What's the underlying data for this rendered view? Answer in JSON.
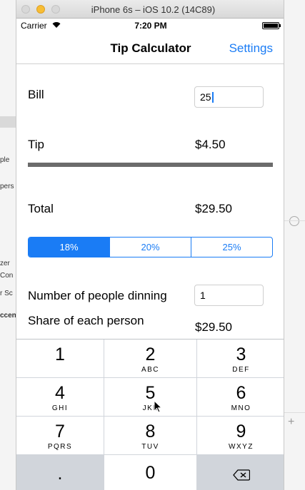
{
  "window": {
    "title": "iPhone 6s – iOS 10.2 (14C89)"
  },
  "status_bar": {
    "carrier": "Carrier",
    "time": "7:20 PM"
  },
  "nav": {
    "title": "Tip Calculator",
    "settings_label": "Settings"
  },
  "form": {
    "bill_label": "Bill",
    "bill_value": "25",
    "tip_label": "Tip",
    "tip_value": "$4.50",
    "total_label": "Total",
    "total_value": "$29.50",
    "tip_options": [
      "18%",
      "20%",
      "25%"
    ],
    "selected_tip_index": 0,
    "people_label": "Number of people dinning",
    "people_value": "1",
    "share_label": "Share of each person",
    "share_value": "$29.50"
  },
  "keypad": {
    "keys": [
      {
        "num": "1",
        "sub": ""
      },
      {
        "num": "2",
        "sub": "ABC"
      },
      {
        "num": "3",
        "sub": "DEF"
      },
      {
        "num": "4",
        "sub": "GHI"
      },
      {
        "num": "5",
        "sub": "JKL"
      },
      {
        "num": "6",
        "sub": "MNO"
      },
      {
        "num": "7",
        "sub": "PQRS"
      },
      {
        "num": "8",
        "sub": "TUV"
      },
      {
        "num": "9",
        "sub": "WXYZ"
      },
      {
        "num": ".",
        "sub": ""
      },
      {
        "num": "0",
        "sub": ""
      }
    ],
    "delete_icon": "backspace-icon"
  },
  "background": {
    "left_fragments": [
      "ple",
      "pers",
      "zer",
      "Con",
      "r Sc",
      "ccen"
    ]
  },
  "colors": {
    "accent": "#1a7cf5",
    "slider_track": "#6b6b6b",
    "keypad_bg": "#d1d5db"
  }
}
